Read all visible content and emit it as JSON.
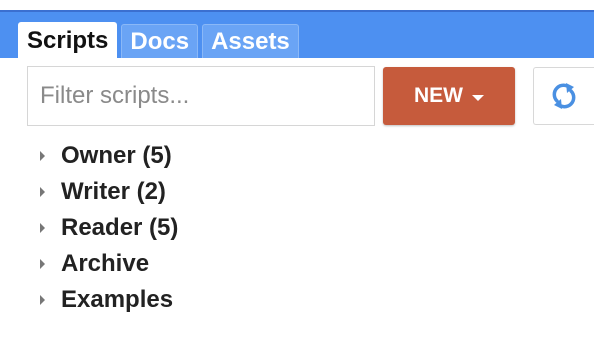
{
  "tabs": [
    {
      "label": "Scripts",
      "active": true
    },
    {
      "label": "Docs",
      "active": false
    },
    {
      "label": "Assets",
      "active": false
    }
  ],
  "toolbar": {
    "filter_placeholder": "Filter scripts...",
    "filter_value": "",
    "new_label": "NEW",
    "new_icon": "caret-down-icon",
    "refresh_icon": "refresh-icon"
  },
  "tree": {
    "items": [
      {
        "label": "Owner (5)"
      },
      {
        "label": "Writer (2)"
      },
      {
        "label": "Reader (5)"
      },
      {
        "label": "Archive"
      },
      {
        "label": "Examples"
      }
    ]
  },
  "colors": {
    "tabbar": "#4d90f1",
    "new_button": "#c65b3c",
    "refresh_icon": "#4a90e2"
  }
}
